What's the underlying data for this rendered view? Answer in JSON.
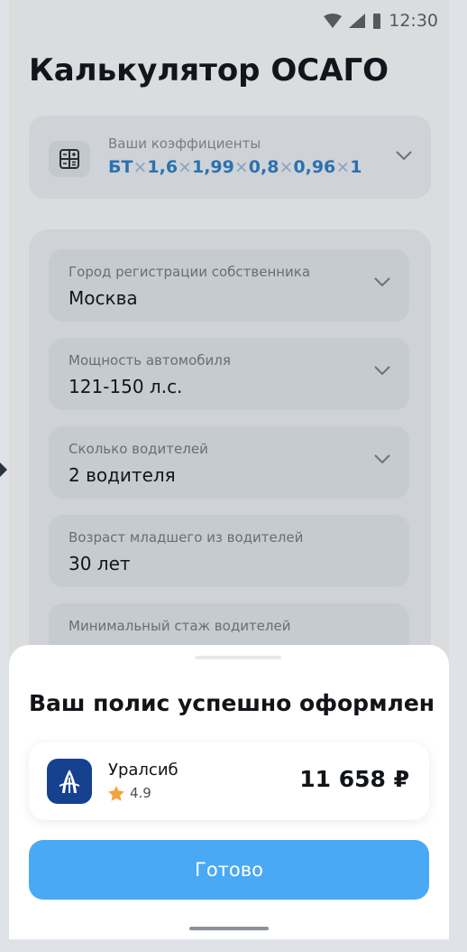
{
  "status": {
    "time": "12:30"
  },
  "page": {
    "title": "Калькулятор ОСАГО"
  },
  "coefficients": {
    "label": "Ваши коэффициенты",
    "parts": [
      "БТ",
      "1,6",
      "1,99",
      "0,8",
      "0,96",
      "1"
    ]
  },
  "form": {
    "fields": [
      {
        "label": "Город регистрации собственника",
        "value": "Москва"
      },
      {
        "label": "Мощность автомобиля",
        "value": "121-150 л.с."
      },
      {
        "label": "Сколько водителей",
        "value": "2 водителя"
      },
      {
        "label": "Возраст младшего из водителей",
        "value": "30 лет"
      },
      {
        "label": "Минимальный стаж водителей",
        "value": ""
      }
    ]
  },
  "sheet": {
    "title": "Ваш полис успешно оформлен",
    "insurer": {
      "name": "Уралсиб",
      "rating": "4.9",
      "price": "11 658 ₽"
    },
    "button_label": "Готово"
  },
  "colors": {
    "accent": "#4aa9f4",
    "formula": "#2f80c9",
    "star": "#f2a33a",
    "logo_bg": "#16418f"
  }
}
